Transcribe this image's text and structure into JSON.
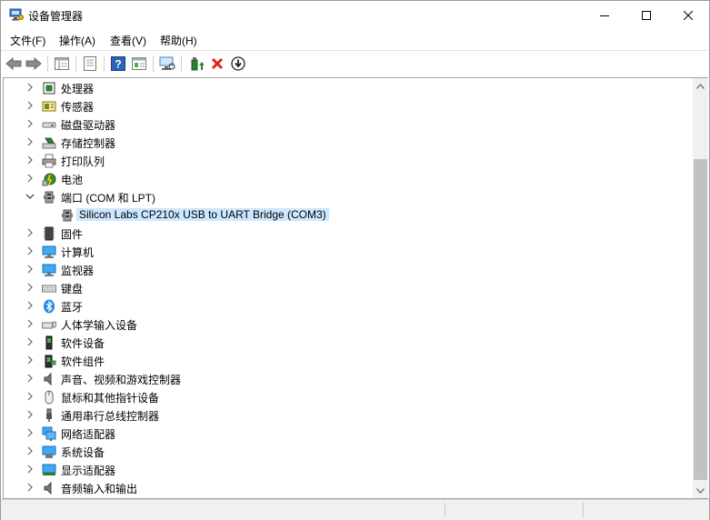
{
  "window": {
    "title": "设备管理器"
  },
  "menu": [
    "文件(F)",
    "操作(A)",
    "查看(V)",
    "帮助(H)"
  ],
  "toolbar": {
    "buttons": [
      "back-icon",
      "forward-icon",
      "show-hide-tree-icon",
      "properties-icon",
      "help-icon",
      "view-icon",
      "scan-hardware-icon",
      "update-driver-icon",
      "uninstall-icon",
      "disable-icon"
    ]
  },
  "tree": [
    {
      "label": "处理器",
      "icon": "processor-icon",
      "expanded": false,
      "level": 0
    },
    {
      "label": "传感器",
      "icon": "sensor-icon",
      "expanded": false,
      "level": 0
    },
    {
      "label": "磁盘驱动器",
      "icon": "disk-drive-icon",
      "expanded": false,
      "level": 0
    },
    {
      "label": "存储控制器",
      "icon": "storage-controller-icon",
      "expanded": false,
      "level": 0
    },
    {
      "label": "打印队列",
      "icon": "printer-icon",
      "expanded": false,
      "level": 0
    },
    {
      "label": "电池",
      "icon": "battery-icon",
      "expanded": false,
      "level": 0
    },
    {
      "label": "端口 (COM 和 LPT)",
      "icon": "port-icon",
      "expanded": true,
      "level": 0
    },
    {
      "label": "Silicon Labs CP210x USB to UART Bridge (COM3)",
      "icon": "port-device-icon",
      "expanded": null,
      "level": 1,
      "selected": true
    },
    {
      "label": "固件",
      "icon": "firmware-icon",
      "expanded": false,
      "level": 0
    },
    {
      "label": "计算机",
      "icon": "computer-icon",
      "expanded": false,
      "level": 0
    },
    {
      "label": "监视器",
      "icon": "monitor-icon",
      "expanded": false,
      "level": 0
    },
    {
      "label": "键盘",
      "icon": "keyboard-icon",
      "expanded": false,
      "level": 0
    },
    {
      "label": "蓝牙",
      "icon": "bluetooth-icon",
      "expanded": false,
      "level": 0
    },
    {
      "label": "人体学输入设备",
      "icon": "hid-icon",
      "expanded": false,
      "level": 0
    },
    {
      "label": "软件设备",
      "icon": "software-device-icon",
      "expanded": false,
      "level": 0
    },
    {
      "label": "软件组件",
      "icon": "software-component-icon",
      "expanded": false,
      "level": 0
    },
    {
      "label": "声音、视频和游戏控制器",
      "icon": "sound-icon",
      "expanded": false,
      "level": 0
    },
    {
      "label": "鼠标和其他指针设备",
      "icon": "mouse-icon",
      "expanded": false,
      "level": 0
    },
    {
      "label": "通用串行总线控制器",
      "icon": "usb-icon",
      "expanded": false,
      "level": 0
    },
    {
      "label": "网络适配器",
      "icon": "network-adapter-icon",
      "expanded": false,
      "level": 0
    },
    {
      "label": "系统设备",
      "icon": "system-device-icon",
      "expanded": false,
      "level": 0
    },
    {
      "label": "显示适配器",
      "icon": "display-adapter-icon",
      "expanded": false,
      "level": 0
    },
    {
      "label": "音频输入和输出",
      "icon": "audio-io-icon",
      "expanded": false,
      "level": 0
    }
  ],
  "colors": {
    "selection": "#cce8ff",
    "accent": "#0078d7"
  }
}
